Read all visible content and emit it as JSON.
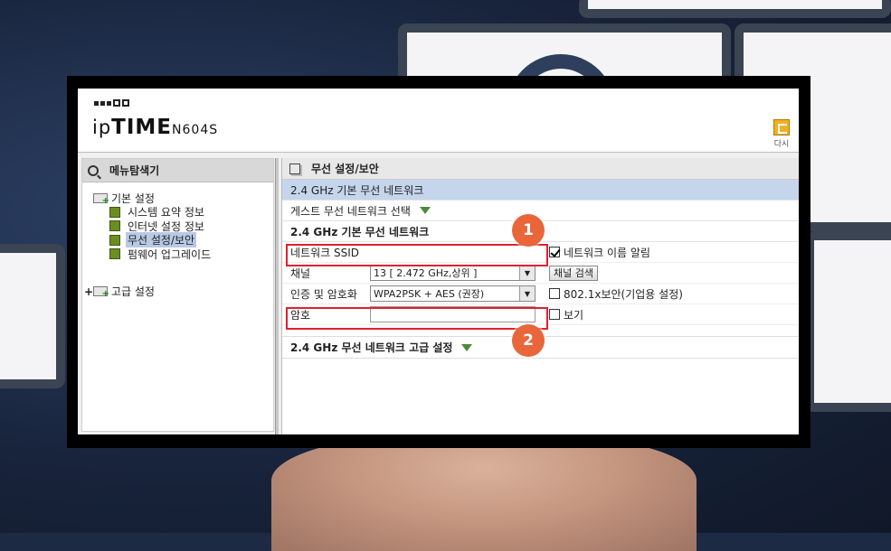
{
  "app": {
    "brand_prefix": "ip",
    "brand_main": "TIME",
    "model": "N604S",
    "redo_label": "다시"
  },
  "sidebar": {
    "title": "메뉴탐색기",
    "groups": [
      {
        "label": "기본 설정",
        "expanded": true,
        "items": [
          {
            "label": "시스템 요약 정보",
            "selected": false
          },
          {
            "label": "인터넷 설정 정보",
            "selected": false
          },
          {
            "label": "무선 설정/보안",
            "selected": true
          },
          {
            "label": "펌웨어 업그레이드",
            "selected": false
          }
        ]
      },
      {
        "label": "고급 설정",
        "expanded": false,
        "items": []
      }
    ]
  },
  "main": {
    "title": "무선 설정/보안",
    "section_basic": "2.4 GHz 기본 무선 네트워크",
    "guest_select": "게스트 무선 네트워크 선택",
    "section_sub": "2.4 GHz 기본 무선 네트워크",
    "fields": {
      "ssid": {
        "label": "네트워크 SSID",
        "value": ""
      },
      "ssid_broadcast": {
        "label": "네트워크 이름 알림",
        "checked": true
      },
      "channel": {
        "label": "채널",
        "value": "13 [ 2.472 GHz,상위 ]",
        "button": "채널 검색"
      },
      "auth": {
        "label": "인증 및 암호화",
        "value": "WPA2PSK + AES (권장)"
      },
      "enterprise": {
        "label": "802.1x보안(기업용 설정)",
        "checked": false
      },
      "password": {
        "label": "암호",
        "value": ""
      },
      "show": {
        "label": "보기",
        "checked": false
      }
    },
    "section_advanced": "2.4 GHz 무선 네트워크 고급 설정"
  },
  "annotations": {
    "badge1": "1",
    "badge2": "2",
    "color": "#e02030"
  }
}
